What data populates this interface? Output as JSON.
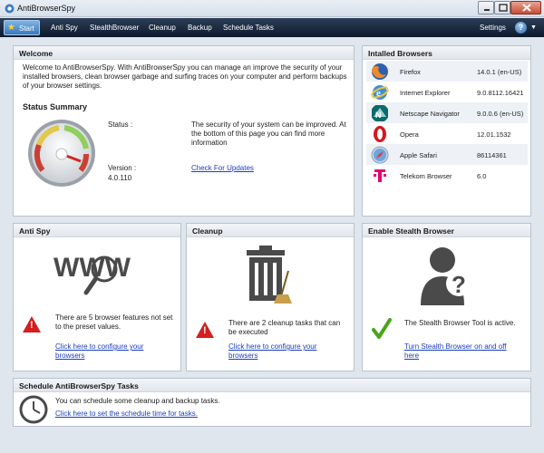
{
  "window": {
    "title": "AntiBrowserSpy"
  },
  "menu": {
    "start": "Start",
    "items": [
      "Anti Spy",
      "StealthBrowser",
      "Cleanup",
      "Backup",
      "Schedule Tasks"
    ],
    "settings": "Settings",
    "help": "?"
  },
  "welcome": {
    "heading": "Welcome",
    "intro": "Welcome to AntiBrowserSpy. With AntiBrowserSpy you can manage an improve the security of your installed browsers, clean browser garbage and surfing traces on your computer and perform backups of your browser settings.",
    "status_heading": "Status Summary",
    "status_label": "Status :",
    "status_text": "The security of your system can be improved. At the bottom of this page you can find more information",
    "version_label": "Version :",
    "version_value": "4.0.110",
    "update_link": "Check For Updates"
  },
  "browsers": {
    "heading": "Intalled Browsers",
    "list": [
      {
        "name": "Firefox",
        "version": "14.0.1 (en-US)",
        "icon": "firefox-icon"
      },
      {
        "name": "Internet Explorer",
        "version": "9.0.8112.16421",
        "icon": "ie-icon"
      },
      {
        "name": "Netscape Navigator",
        "version": "9.0.0.6 (en-US)",
        "icon": "netscape-icon"
      },
      {
        "name": "Opera",
        "version": "12.01.1532",
        "icon": "opera-icon"
      },
      {
        "name": "Apple Safari",
        "version": "86114361",
        "icon": "safari-icon"
      },
      {
        "name": "Telekom Browser",
        "version": "6.0",
        "icon": "telekom-icon"
      }
    ]
  },
  "antispy": {
    "heading": "Anti Spy",
    "logo_text": "WWW",
    "message": "There are 5 browser features not set to the preset values.",
    "link": "Click here to configure your browsers"
  },
  "cleanup": {
    "heading": "Cleanup",
    "message": "There are 2 cleanup tasks that can be executed",
    "link": "Click here to configure your browsers"
  },
  "stealth": {
    "heading": "Enable Stealth Browser",
    "message": "The Stealth Browser Tool is active.",
    "link": "Turn Stealth Browser on and off here"
  },
  "schedule": {
    "heading": "Schedule AntiBrowserSpy Tasks",
    "message": "You can schedule some cleanup and backup tasks.",
    "link": "Click here to set the schedule time for tasks."
  },
  "colors": {
    "accent": "#1a3dbf",
    "warning": "#d21f1f",
    "ok": "#4aa51a",
    "menubar": "#16243a"
  }
}
